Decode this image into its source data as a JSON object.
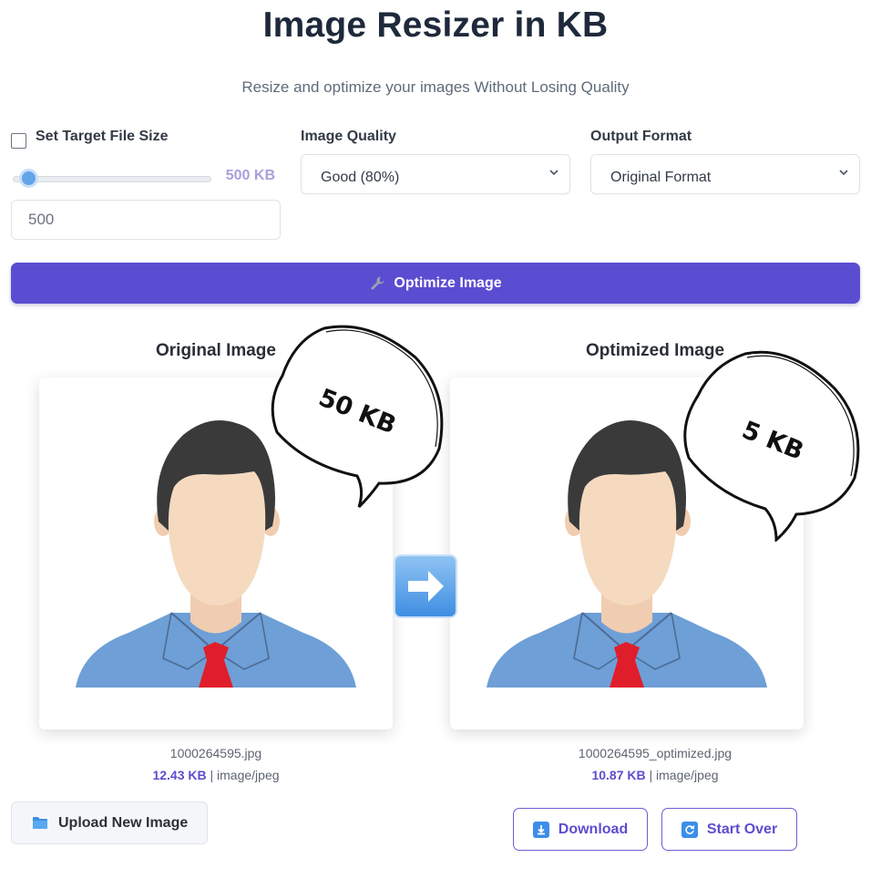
{
  "app": {
    "title": "Image Resizer in KB",
    "subtitle": "Resize and optimize your images Without Losing Quality"
  },
  "controls": {
    "target_size": {
      "label": "Set Target File Size",
      "checked": false,
      "slider_value_label": "500 KB",
      "slider_fraction": 0.04,
      "input_value": "500"
    },
    "quality": {
      "label": "Image Quality",
      "selected": "Good (80%)"
    },
    "format": {
      "label": "Output Format",
      "selected": "Original Format"
    },
    "optimize_button": {
      "icon": "wrench-icon",
      "label": "Optimize Image"
    }
  },
  "original": {
    "heading": "Original Image",
    "filename": "1000264595.jpg",
    "size": "12.43 KB",
    "type": "image/jpeg",
    "bubble_text": "50 KB"
  },
  "optimized": {
    "heading": "Optimized Image",
    "filename": "1000264595_optimized.jpg",
    "size": "10.87 KB",
    "type": "image/jpeg",
    "bubble_text": "5 KB"
  },
  "actions": {
    "upload_label": "Upload New Image",
    "upload_icon": "folder-icon",
    "download_label": "Download",
    "download_icon": "download-icon",
    "start_over_label": "Start Over",
    "start_over_icon": "refresh-icon"
  },
  "colors": {
    "accent": "#5b4dd1",
    "slider_thumb": "#63a4ea",
    "arrow": "#3f8ee2"
  }
}
